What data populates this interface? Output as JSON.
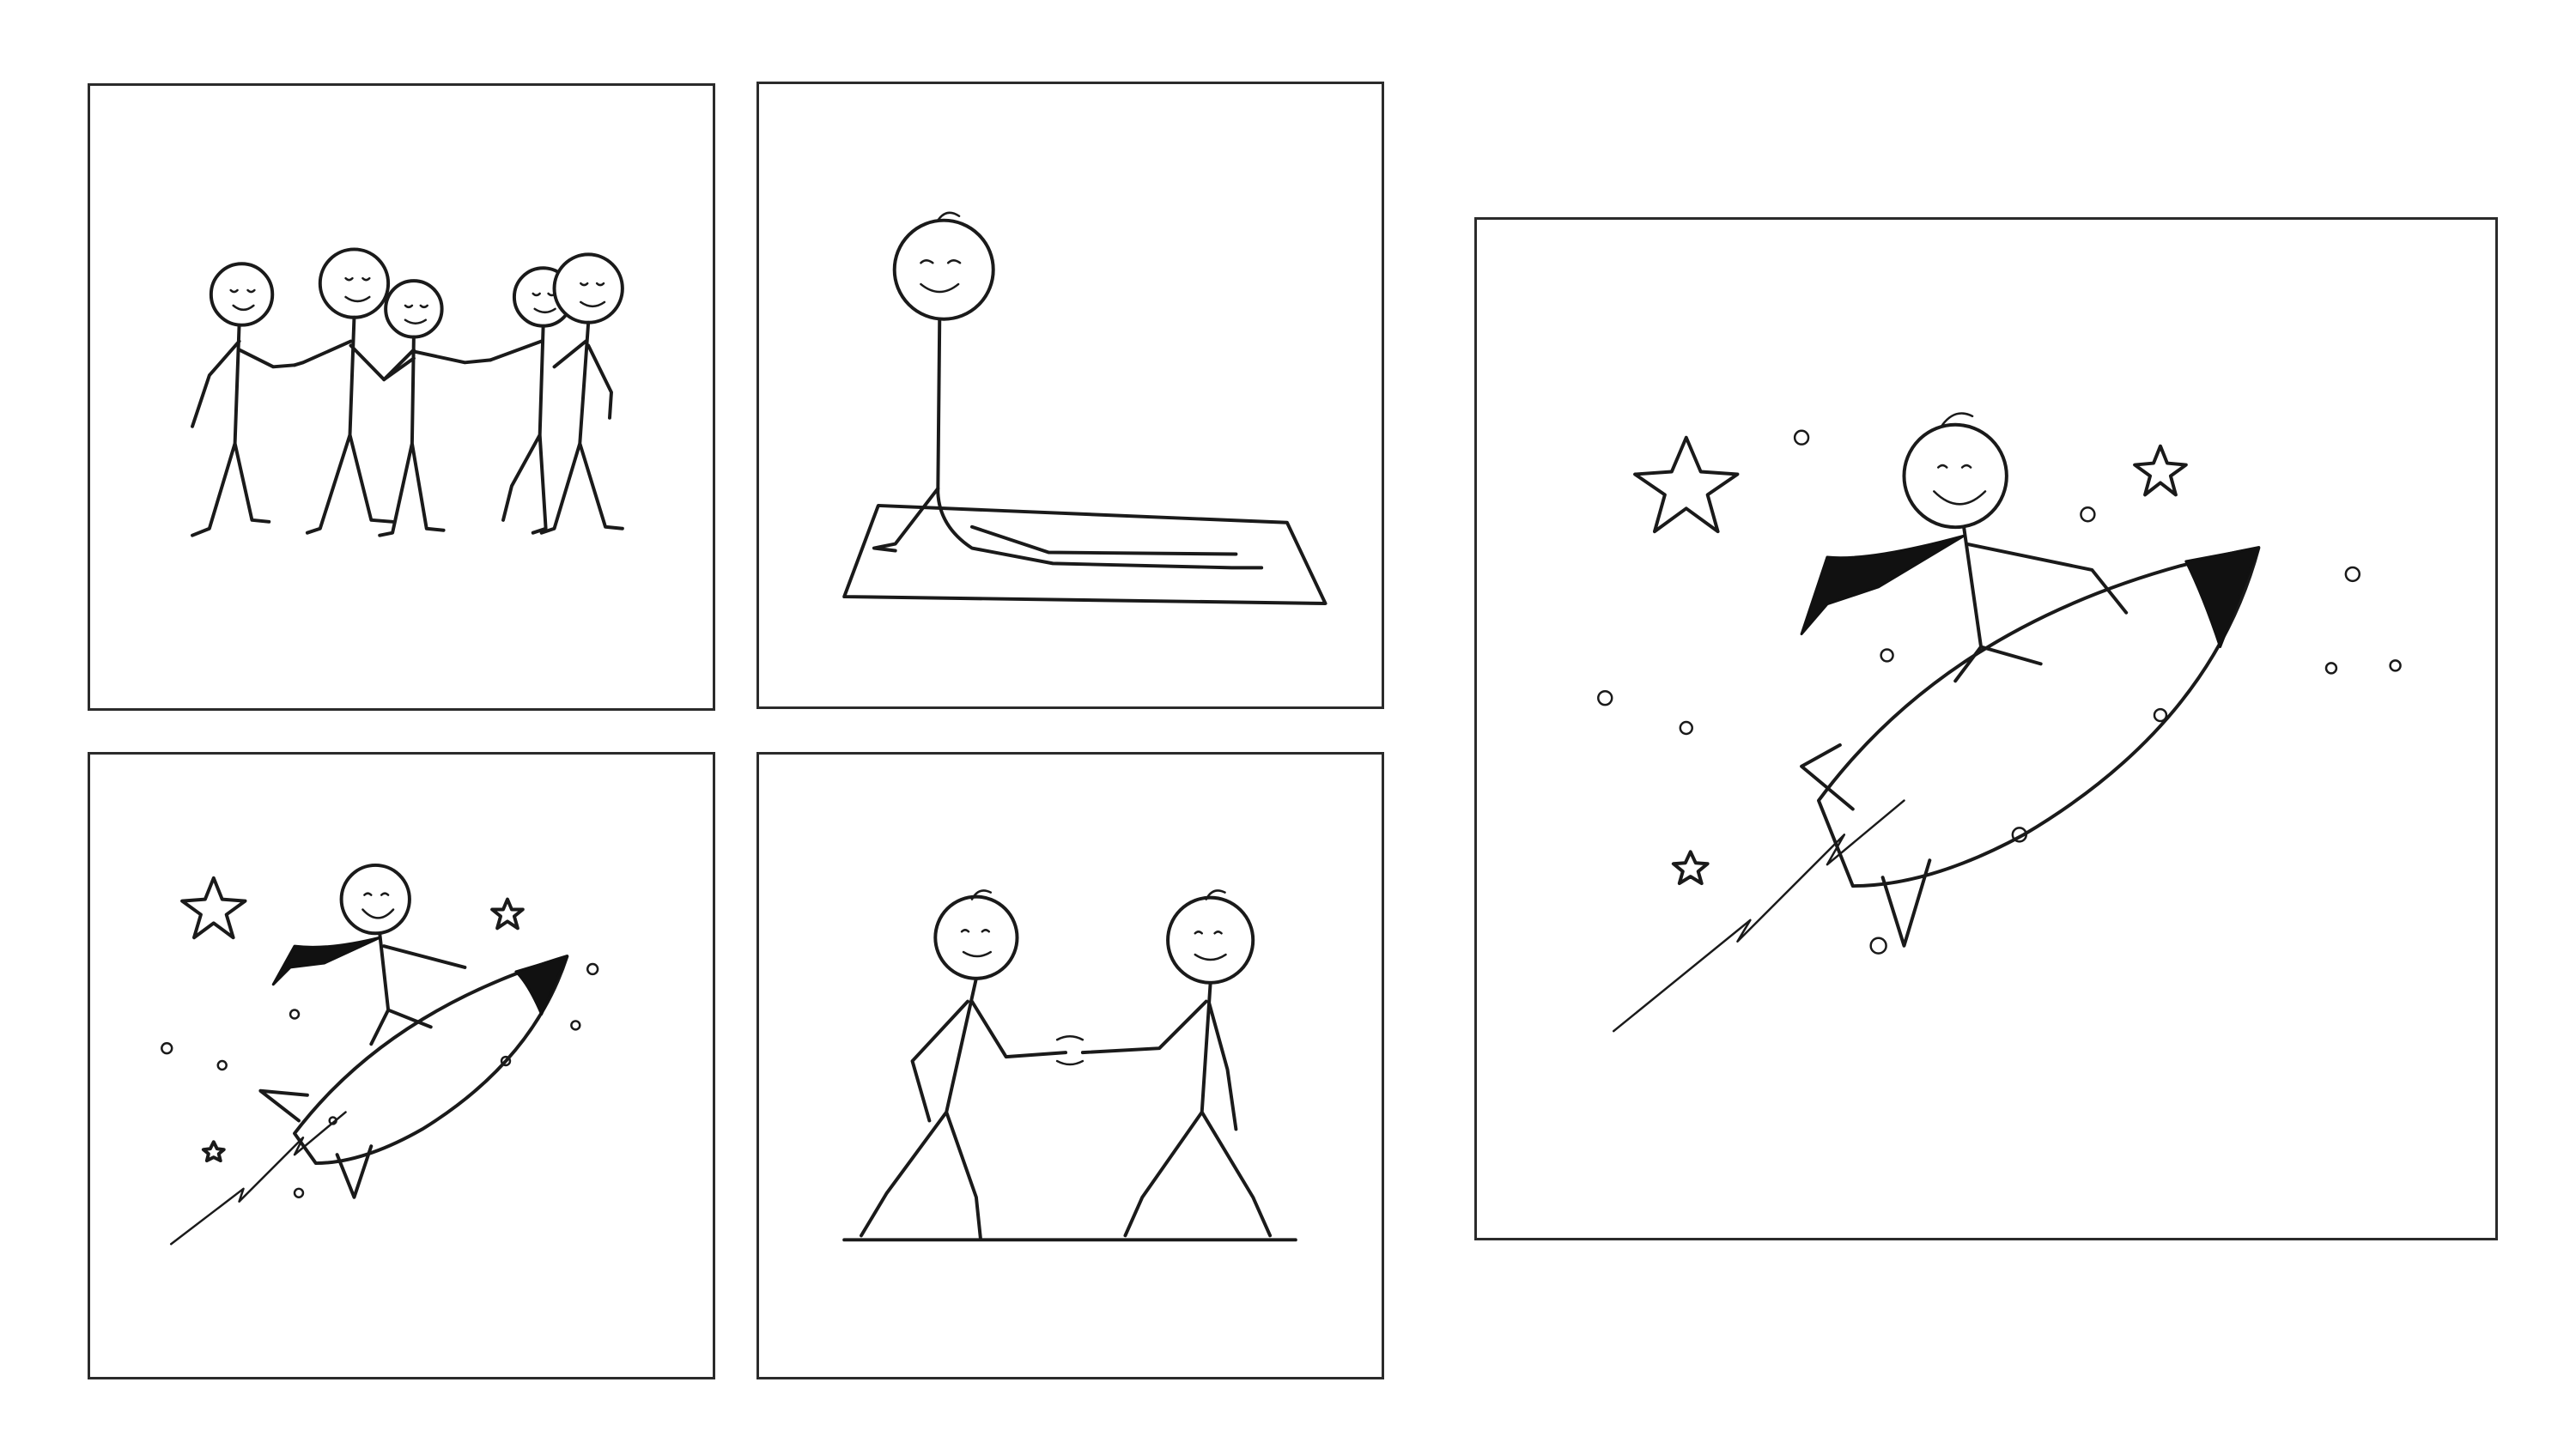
{
  "tiles": [
    {
      "id": "team",
      "description_icon": "team-huddle-illustration"
    },
    {
      "id": "yoga",
      "description_icon": "yoga-cobra-pose-illustration"
    },
    {
      "id": "rocket-small",
      "description_icon": "businessman-riding-rocket-illustration"
    },
    {
      "id": "handshake",
      "description_icon": "handshake-illustration"
    },
    {
      "id": "rocket-large",
      "description_icon": "businessman-riding-rocket-illustration"
    }
  ],
  "colors": {
    "background": "#ffffff",
    "frame": "#2b2b2b",
    "ink": "#1a1a1a"
  }
}
